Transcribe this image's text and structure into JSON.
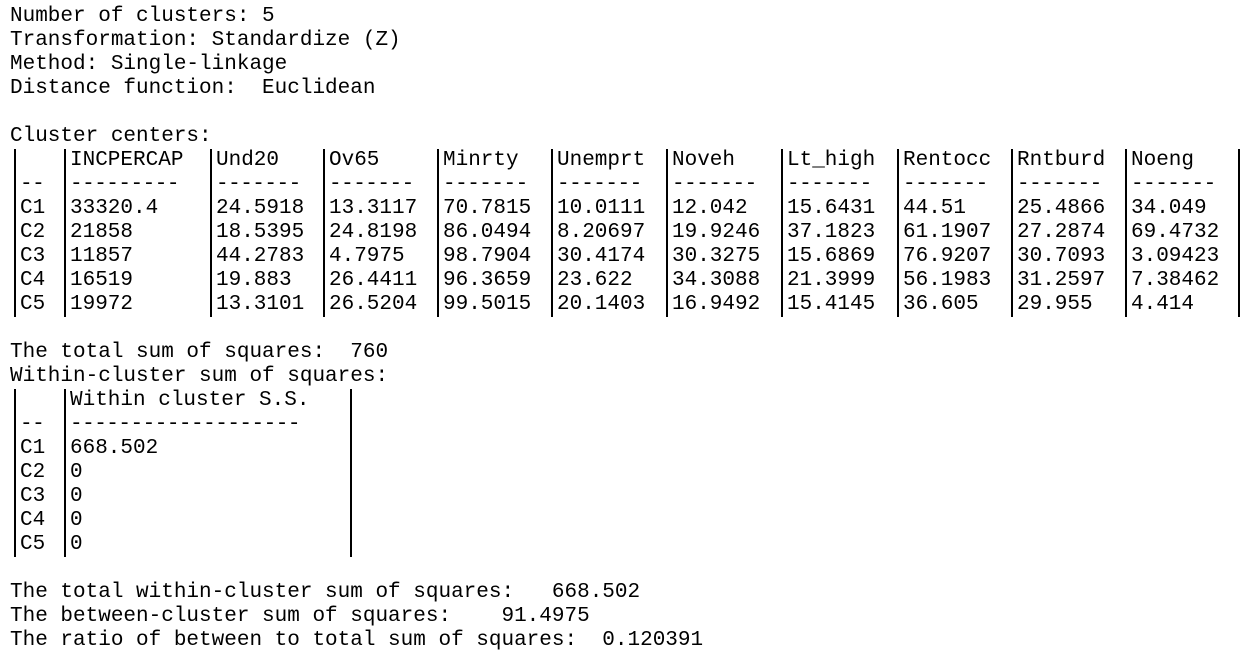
{
  "header": {
    "num_clusters": "Number of clusters: 5",
    "transformation": "Transformation: Standardize (Z)",
    "method": "Method: Single-linkage",
    "distance": "Distance function:  Euclidean"
  },
  "centers": {
    "title": "Cluster centers:",
    "columns": [
      "",
      "INCPERCAP",
      "Und20",
      "Ov65",
      "Minrty",
      "Unemprt",
      "Noveh",
      "Lt_high",
      "Rentocc",
      "Rntburd",
      "Noeng"
    ],
    "dashes": [
      "--",
      "---------",
      "-------",
      "-------",
      "-------",
      "-------",
      "-------",
      "-------",
      "-------",
      "-------",
      "-------"
    ],
    "rows": [
      [
        "C1",
        "33320.4",
        "24.5918",
        "13.3117",
        "70.7815",
        "10.0111",
        "12.042",
        "15.6431",
        "44.51",
        "25.4866",
        "34.049"
      ],
      [
        "C2",
        "21858",
        "18.5395",
        "24.8198",
        "86.0494",
        "8.20697",
        "19.9246",
        "37.1823",
        "61.1907",
        "27.2874",
        "69.4732"
      ],
      [
        "C3",
        "11857",
        "44.2783",
        "4.7975",
        "98.7904",
        "30.4174",
        "30.3275",
        "15.6869",
        "76.9207",
        "30.7093",
        "3.09423"
      ],
      [
        "C4",
        "16519",
        "19.883",
        "26.4411",
        "96.3659",
        "23.622",
        "34.3088",
        "21.3999",
        "56.1983",
        "31.2597",
        "7.38462"
      ],
      [
        "C5",
        "19972",
        "13.3101",
        "26.5204",
        "99.5015",
        "20.1403",
        "16.9492",
        "15.4145",
        "36.605",
        "29.955",
        "4.414"
      ]
    ]
  },
  "totals": {
    "total_ss": "The total sum of squares:  760",
    "within_title": "Within-cluster sum of squares:"
  },
  "within": {
    "columns": [
      "",
      "Within cluster S.S."
    ],
    "dashes": [
      "--",
      "-------------------"
    ],
    "rows": [
      [
        "C1",
        "668.502"
      ],
      [
        "C2",
        "0"
      ],
      [
        "C3",
        "0"
      ],
      [
        "C4",
        "0"
      ],
      [
        "C5",
        "0"
      ]
    ]
  },
  "summary": {
    "total_within": "The total within-cluster sum of squares:   668.502",
    "between": "The between-cluster sum of squares:    91.4975",
    "ratio": "The ratio of between to total sum of squares:  0.120391"
  }
}
